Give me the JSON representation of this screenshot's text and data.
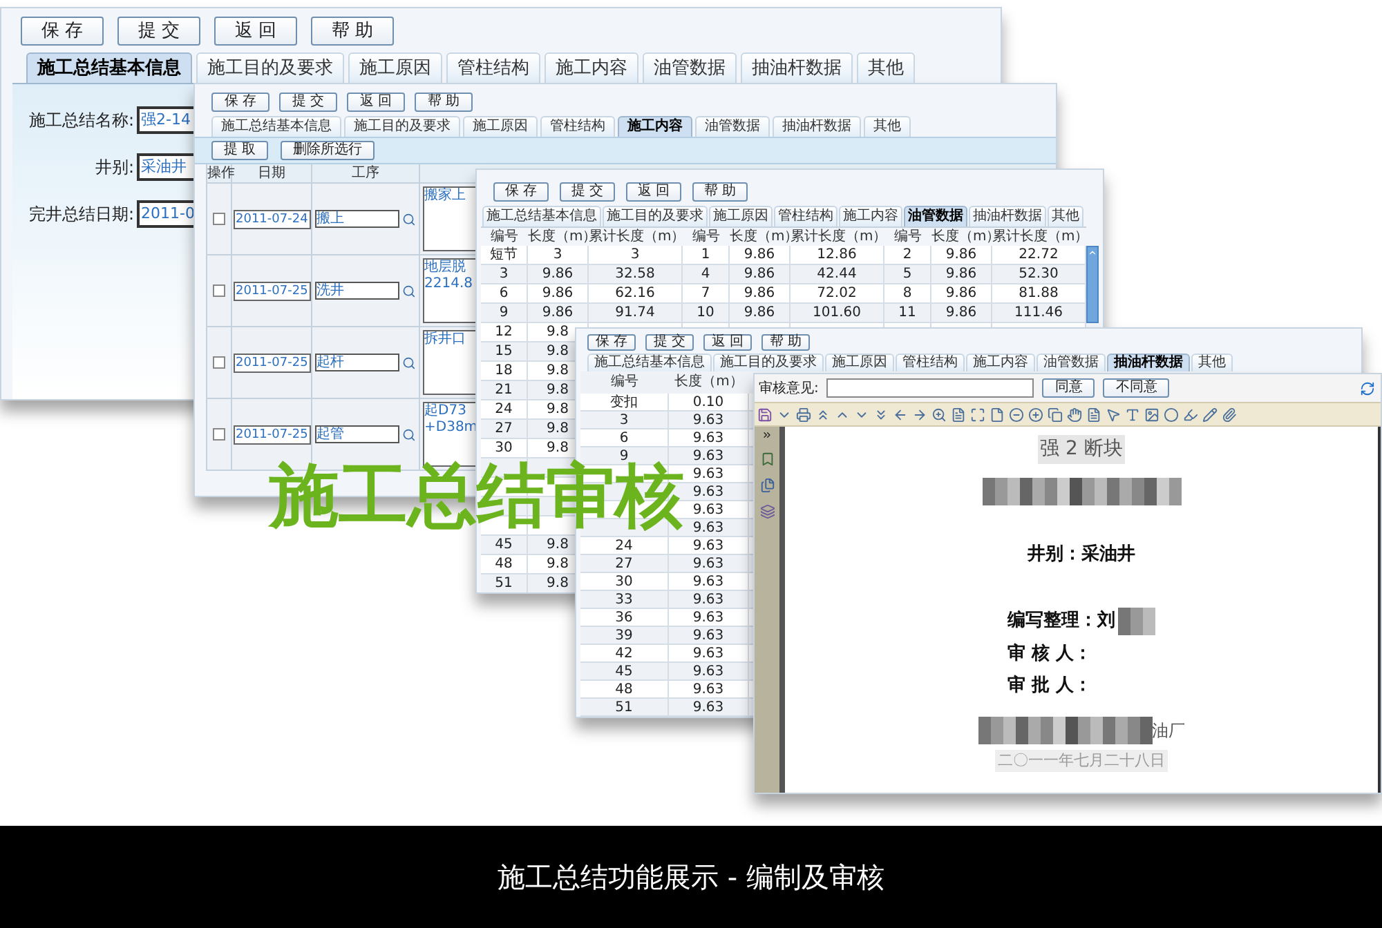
{
  "form_window": {
    "buttons": [
      "保 存",
      "提 交",
      "返 回",
      "帮 助"
    ],
    "tabs": [
      {
        "label": "施工总结基本信息",
        "selected": true
      },
      {
        "label": "施工目的及要求",
        "selected": false
      },
      {
        "label": "施工原因",
        "selected": false
      },
      {
        "label": "管柱结构",
        "selected": false
      },
      {
        "label": "施工内容",
        "selected": false
      },
      {
        "label": "油管数据",
        "selected": false
      },
      {
        "label": "抽油杆数据",
        "selected": false
      },
      {
        "label": "其他",
        "selected": false
      }
    ],
    "fields": [
      {
        "label": "施工总结名称:",
        "value": "强2-14"
      },
      {
        "label": "井别:",
        "value": "采油井"
      },
      {
        "label": "完井总结日期:",
        "value": "2011-0"
      }
    ]
  },
  "content_window": {
    "buttons": [
      "保 存",
      "提 交",
      "返 回",
      "帮 助"
    ],
    "tabs": [
      {
        "label": "施工总结基本信息",
        "selected": false
      },
      {
        "label": "施工目的及要求",
        "selected": false
      },
      {
        "label": "施工原因",
        "selected": false
      },
      {
        "label": "管柱结构",
        "selected": false
      },
      {
        "label": "施工内容",
        "selected": true
      },
      {
        "label": "油管数据",
        "selected": false
      },
      {
        "label": "抽油杆数据",
        "selected": false
      },
      {
        "label": "其他",
        "selected": false
      }
    ],
    "actions": [
      "提 取",
      "删除所选行"
    ],
    "columns": [
      "操作",
      "日期",
      "工序"
    ],
    "rows": [
      {
        "checked": false,
        "date": "2011-07-24",
        "step": "搬上",
        "content": [
          "搬家上"
        ]
      },
      {
        "checked": false,
        "date": "2011-07-25",
        "step": "洗井",
        "content": [
          "地层脱",
          "2214.8"
        ]
      },
      {
        "checked": false,
        "date": "2011-07-25",
        "step": "起杆",
        "content": [
          "拆井口"
        ]
      },
      {
        "checked": false,
        "date": "2011-07-25",
        "step": "起管",
        "content": [
          "起D73",
          "+D38m"
        ]
      }
    ]
  },
  "tubing_window": {
    "buttons": [
      "保 存",
      "提 交",
      "返 回",
      "帮 助"
    ],
    "tabs": [
      {
        "label": "施工总结基本信息",
        "selected": false
      },
      {
        "label": "施工目的及要求",
        "selected": false
      },
      {
        "label": "施工原因",
        "selected": false
      },
      {
        "label": "管柱结构",
        "selected": false
      },
      {
        "label": "施工内容",
        "selected": false
      },
      {
        "label": "油管数据",
        "selected": true
      },
      {
        "label": "抽油杆数据",
        "selected": false
      },
      {
        "label": "其他",
        "selected": false
      }
    ],
    "columns": [
      "编号",
      "长度（m）",
      "累计长度（m）",
      "编号",
      "长度（m）",
      "累计长度（m）",
      "编号",
      "长度（m）",
      "累计长度（m）"
    ],
    "rows": [
      [
        "短节",
        "3",
        "3",
        "1",
        "9.86",
        "12.86",
        "2",
        "9.86",
        "22.72"
      ],
      [
        "3",
        "9.86",
        "32.58",
        "4",
        "9.86",
        "42.44",
        "5",
        "9.86",
        "52.30"
      ],
      [
        "6",
        "9.86",
        "62.16",
        "7",
        "9.86",
        "72.02",
        "8",
        "9.86",
        "81.88"
      ],
      [
        "9",
        "9.86",
        "91.74",
        "10",
        "9.86",
        "101.60",
        "11",
        "9.86",
        "111.46"
      ],
      [
        "12",
        "9.8"
      ],
      [
        "15",
        "9.8"
      ],
      [
        "18",
        "9.8"
      ],
      [
        "21",
        "9.8"
      ],
      [
        "24",
        "9.8"
      ],
      [
        "27",
        "9.8"
      ],
      [
        "30",
        "9.8"
      ],
      [
        null,
        null
      ],
      [
        null,
        null
      ],
      [
        null,
        null
      ],
      [
        null,
        null
      ],
      [
        "45",
        "9.8"
      ],
      [
        "48",
        "9.8"
      ],
      [
        "51",
        "9.8"
      ]
    ]
  },
  "rod_window": {
    "buttons": [
      "保 存",
      "提 交",
      "返 回",
      "帮 助"
    ],
    "tabs": [
      {
        "label": "施工总结基本信息",
        "selected": false
      },
      {
        "label": "施工目的及要求",
        "selected": false
      },
      {
        "label": "施工原因",
        "selected": false
      },
      {
        "label": "管柱结构",
        "selected": false
      },
      {
        "label": "施工内容",
        "selected": false
      },
      {
        "label": "油管数据",
        "selected": false
      },
      {
        "label": "抽油杆数据",
        "selected": true
      },
      {
        "label": "其他",
        "selected": false
      }
    ],
    "columns": [
      "编号",
      "长度（m）"
    ],
    "rows": [
      [
        "变扣",
        "0.10"
      ],
      [
        "3",
        "9.63"
      ],
      [
        "6",
        "9.63"
      ],
      [
        "9",
        "9.63"
      ],
      [
        null,
        "9.63"
      ],
      [
        null,
        "9.63"
      ],
      [
        null,
        "9.63"
      ],
      [
        null,
        "9.63"
      ],
      [
        "24",
        "9.63"
      ],
      [
        "27",
        "9.63"
      ],
      [
        "30",
        "9.63"
      ],
      [
        "33",
        "9.63"
      ],
      [
        "36",
        "9.63"
      ],
      [
        "39",
        "9.63"
      ],
      [
        "42",
        "9.63"
      ],
      [
        "45",
        "9.63"
      ],
      [
        "48",
        "9.63"
      ],
      [
        "51",
        "9.63"
      ]
    ]
  },
  "review_window": {
    "opinion_label": "审核意见:",
    "buttons": [
      "同意",
      "不同意"
    ],
    "document": {
      "heading": "强 2 断块",
      "well_type": "井别：采油井",
      "signatures": [
        "编写整理：刘",
        "审 核 人：",
        "审 批 人："
      ],
      "org_line": "油厂",
      "date": "二〇一一年七月二十八日"
    }
  },
  "headline": "施工总结审核",
  "caption": "施工总结功能展示 - 编制及审核"
}
